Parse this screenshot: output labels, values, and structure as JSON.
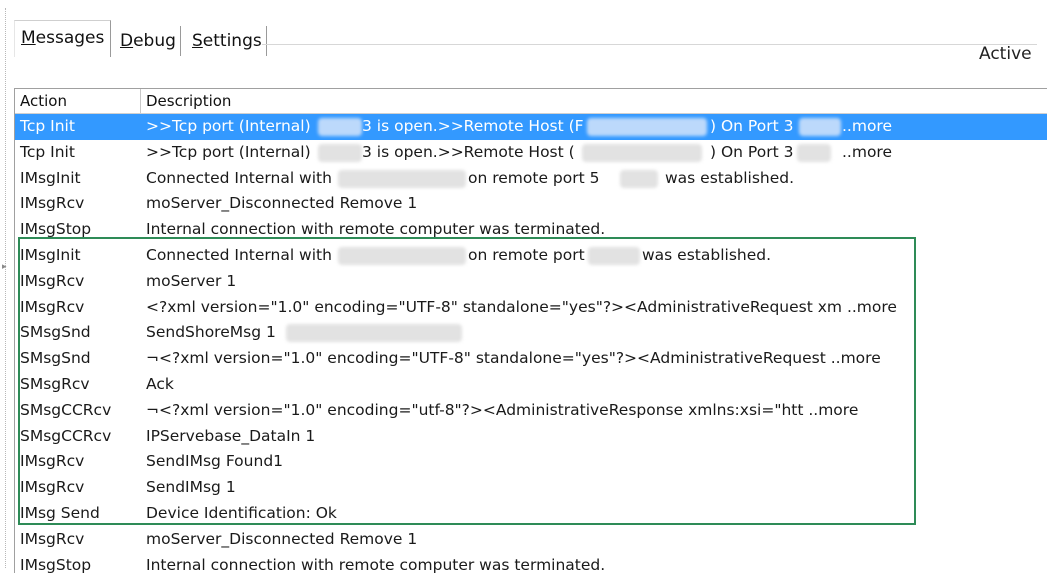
{
  "tabs": {
    "messages": {
      "pre": "",
      "mnemonic": "M",
      "post": "essages"
    },
    "debug": {
      "pre": "",
      "mnemonic": "D",
      "post": "ebug"
    },
    "settings": {
      "pre": "",
      "mnemonic": "S",
      "post": "ettings"
    }
  },
  "status": {
    "label": "Active"
  },
  "table": {
    "columns": [
      "Action",
      "Description"
    ],
    "rows": [
      {
        "action": "Tcp Init",
        "desc_a": ">>Tcp port (Internal)",
        "desc_b": "3 is open.>>Remote Host (F",
        "desc_c": ") On Port 3",
        "desc_d": "..more"
      },
      {
        "action": "Tcp Init",
        "desc_a": ">>Tcp port (Internal)",
        "desc_b": "3 is open.>>Remote Host (",
        "desc_c": ") On Port 3",
        "desc_d": "..more"
      },
      {
        "action": "IMsgInit",
        "desc_a": "Connected Internal with",
        "desc_b": "on remote port 5",
        "desc_c": "was established."
      },
      {
        "action": "IMsgRcv",
        "desc": "moServer_Disconnected Remove 1"
      },
      {
        "action": "IMsgStop",
        "desc": "Internal connection with remote computer was terminated."
      },
      {
        "action": "IMsgInit",
        "desc_a": "Connected Internal with",
        "desc_b": "on remote port",
        "desc_c": "was established."
      },
      {
        "action": "IMsgRcv",
        "desc": "moServer 1"
      },
      {
        "action": "IMsgRcv",
        "desc": "<?xml version=\"1.0\" encoding=\"UTF-8\" standalone=\"yes\"?><AdministrativeRequest xm ..more"
      },
      {
        "action": "SMsgSnd",
        "desc": "SendShoreMsg 1"
      },
      {
        "action": "SMsgSnd",
        "desc": "¬<?xml version=\"1.0\" encoding=\"UTF-8\" standalone=\"yes\"?><AdministrativeRequest  ..more"
      },
      {
        "action": "SMsgRcv",
        "desc": "Ack"
      },
      {
        "action": "SMsgCCRcv",
        "desc": "¬<?xml version=\"1.0\" encoding=\"utf-8\"?><AdministrativeResponse xmlns:xsi=\"htt ..more"
      },
      {
        "action": "SMsgCCRcv",
        "desc": "IPServebase_DataIn 1"
      },
      {
        "action": "IMsgRcv",
        "desc": "SendIMsg Found1"
      },
      {
        "action": "IMsgRcv",
        "desc": "SendIMsg 1"
      },
      {
        "action": "IMsg Send",
        "desc": "Device Identification: Ok"
      },
      {
        "action": "IMsgRcv",
        "desc": "moServer_Disconnected Remove 1"
      },
      {
        "action": "IMsgStop",
        "desc": "Internal connection with remote computer was terminated."
      }
    ]
  }
}
